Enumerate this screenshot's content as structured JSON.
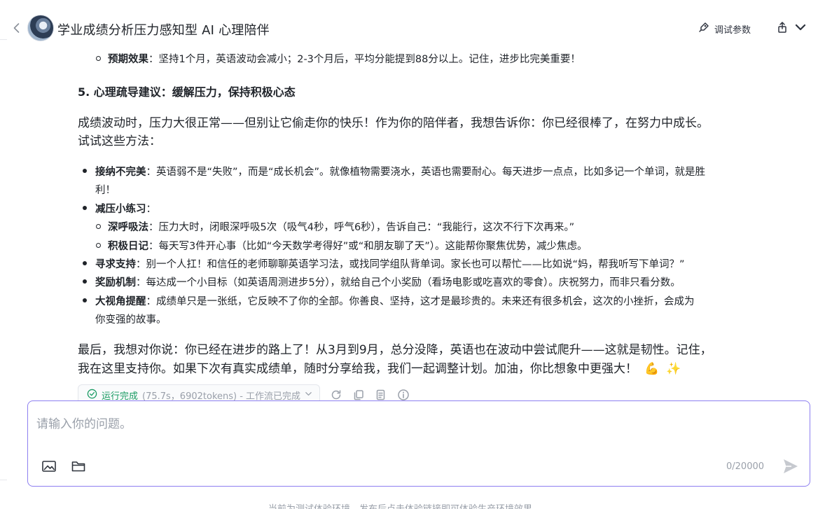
{
  "header": {
    "title": "学业成绩分析压力感知型 AI 心理陪伴",
    "debug_label": "调试参数"
  },
  "message": {
    "expected_effect_label": "预期效果",
    "expected_effect_text": "：坚持1个月，英语波动会减小；2-3个月后，平均分能提到88分以上。记住，进步比完美重要！",
    "section5_title": "5. 心理疏导建议：缓解压力，保持积极心态",
    "intro_line1": "成绩波动时，压力大很正常——但别让它偷走你的快乐！作为你的陪伴者，我想告诉你：你已经很棒了，在努力中成长。",
    "intro_line2": "试试这些方法：",
    "b1_label": "接纳不完美",
    "b1_text1": "：英语弱不是“失败”，而是“成长机会”。就像植物需要浇水，英语也需要耐心。每天进步一点点，比如多记一个单词，就是胜",
    "b1_text2": "利！",
    "b2_label": "减压小练习",
    "b2_colon": "：",
    "b2a_label": "深呼吸法",
    "b2a_text": "：压力大时，闭眼深呼吸5次（吸气4秒，呼气6秒），告诉自己：“我能行，这次不行下次再来。”",
    "b2b_label": "积极日记",
    "b2b_text": "：每天写3件开心事（比如“今天数学考得好”或“和朋友聊了天”）。这能帮你聚焦优势，减少焦虑。",
    "b3_label": "寻求支持",
    "b3_text": "：别一个人扛！和信任的老师聊聊英语学习法，或找同学组队背单词。家长也可以帮忙——比如说“妈，帮我听写下单词？”",
    "b4_label": "奖励机制",
    "b4_text": "：每达成一个小目标（如英语周测进步5分），就给自己个小奖励（看场电影或吃喜欢的零食）。庆祝努力，而非只看分数。",
    "b5_label": "大视角提醒",
    "b5_text1": "：成绩单只是一张纸，它反映不了你的全部。你善良、坚持，这才是最珍贵的。未来还有很多机会，这次的小挫折，会成为",
    "b5_text2": "你变强的故事。",
    "closing_line1": "最后，我想对你说：你已经在进步的路上了！从3月到9月，总分没降，英语也在波动中尝试爬升——这就是韧性。记住，",
    "closing_line2": "我在这里支持你。如果下次有真实成绩单，随时分享给我，我们一起调整计划。加油，你比想象中更强大！",
    "emoji_1": "💪",
    "emoji_2": "✨"
  },
  "status": {
    "label": "运行完成",
    "meta": "(75.7s，6902tokens) - 工作流已完成"
  },
  "composer": {
    "placeholder": "请输入你的问题。",
    "char_count": "0/20000"
  },
  "footer": {
    "note": "当前为测试体验环境，发布后点击体验链接即可体验生产环境效果"
  },
  "colors": {
    "accent_border": "#8d7ff0",
    "status_ok": "#1a9b63",
    "muted": "#9aa0aa"
  },
  "icons": [
    "back-icon",
    "debug-icon",
    "share-icon",
    "chevron-down-icon",
    "check-circle-icon",
    "refresh-icon",
    "copy-icon",
    "note-icon",
    "info-icon",
    "image-icon",
    "folder-icon",
    "send-icon"
  ]
}
